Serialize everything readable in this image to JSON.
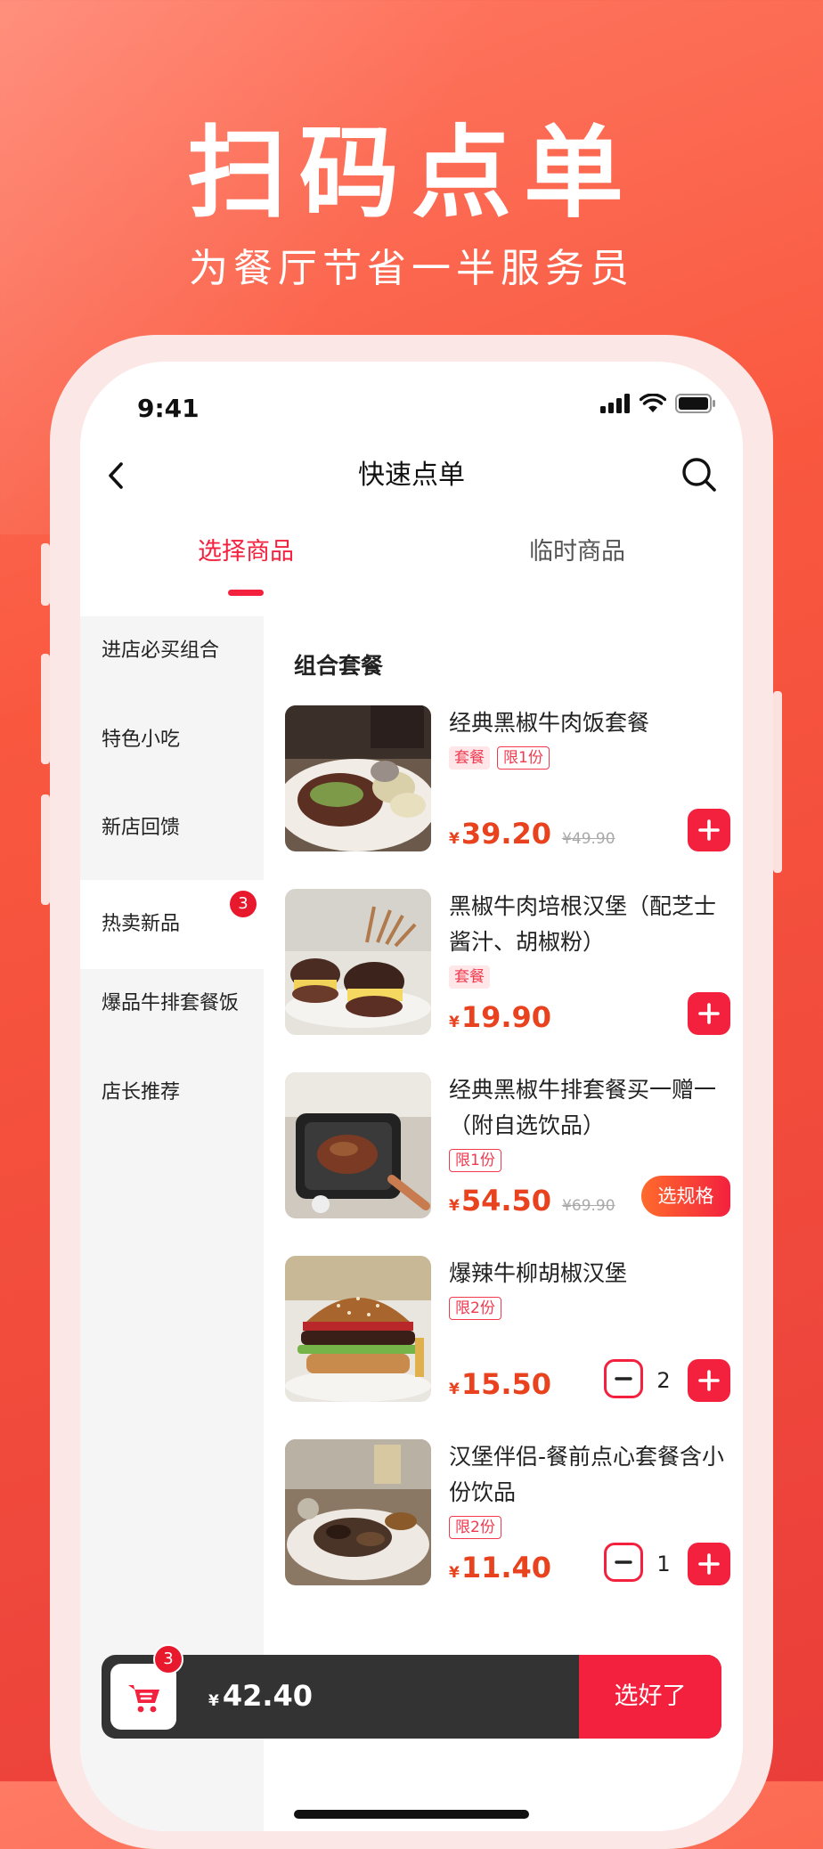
{
  "hero": {
    "title": "扫码点单",
    "subtitle": "为餐厅节省一半服务员"
  },
  "status_bar": {
    "time": "9:41",
    "icons": [
      "signal-icon",
      "wifi-icon",
      "battery-icon"
    ]
  },
  "nav": {
    "title": "快速点单",
    "back_icon": "chevron-left-icon",
    "search_icon": "search-icon"
  },
  "tabs": [
    {
      "label": "选择商品",
      "active": true
    },
    {
      "label": "临时商品",
      "active": false
    }
  ],
  "sidebar": {
    "items": [
      {
        "label": "进店必买组合",
        "active": false
      },
      {
        "label": "特色小吃",
        "active": false
      },
      {
        "label": "新店回馈",
        "active": false
      },
      {
        "label": "热卖新品",
        "active": true,
        "badge": "3"
      },
      {
        "label": "爆品牛排套餐饭",
        "active": false
      },
      {
        "label": "店长推荐",
        "active": false
      }
    ]
  },
  "section_title": "组合套餐",
  "currency": "¥",
  "products": [
    {
      "name": "经典黑椒牛肉饭套餐",
      "tags": [
        {
          "text": "套餐",
          "style": "fill"
        },
        {
          "text": "限1份",
          "style": "outline"
        }
      ],
      "price": "39.20",
      "original_price": "¥49.90",
      "action": "add",
      "image": "steak-plate-photo"
    },
    {
      "name": "黑椒牛肉培根汉堡（配芝士酱汁、胡椒粉）",
      "tags": [
        {
          "text": "套餐",
          "style": "fill"
        }
      ],
      "price": "19.90",
      "action": "add",
      "image": "mini-burgers-photo"
    },
    {
      "name": "经典黑椒牛排套餐买一赠一（附自选饮品）",
      "tags": [
        {
          "text": "限1份",
          "style": "outline"
        }
      ],
      "price": "54.50",
      "original_price": "¥69.90",
      "action": "spec",
      "spec_label": "选规格",
      "image": "steak-pan-photo"
    },
    {
      "name": "爆辣牛柳胡椒汉堡",
      "tags": [
        {
          "text": "限2份",
          "style": "outline"
        }
      ],
      "price": "15.50",
      "action": "stepper",
      "quantity": "2",
      "image": "burger-photo"
    },
    {
      "name": "汉堡伴侣-餐前点心套餐含小份饮品",
      "tags": [
        {
          "text": "限2份",
          "style": "outline"
        }
      ],
      "price": "11.40",
      "action": "stepper",
      "quantity": "1",
      "image": "appetizer-plate-photo"
    }
  ],
  "cart": {
    "badge": "3",
    "currency": "¥",
    "total": "42.40",
    "checkout_label": "选好了",
    "icon": "cart-icon"
  },
  "colors": {
    "accent": "#f3213e",
    "price": "#e8421e",
    "background_top": "#ff7a64",
    "background_bottom": "#ea3d3a",
    "cart_bar": "#333333"
  }
}
